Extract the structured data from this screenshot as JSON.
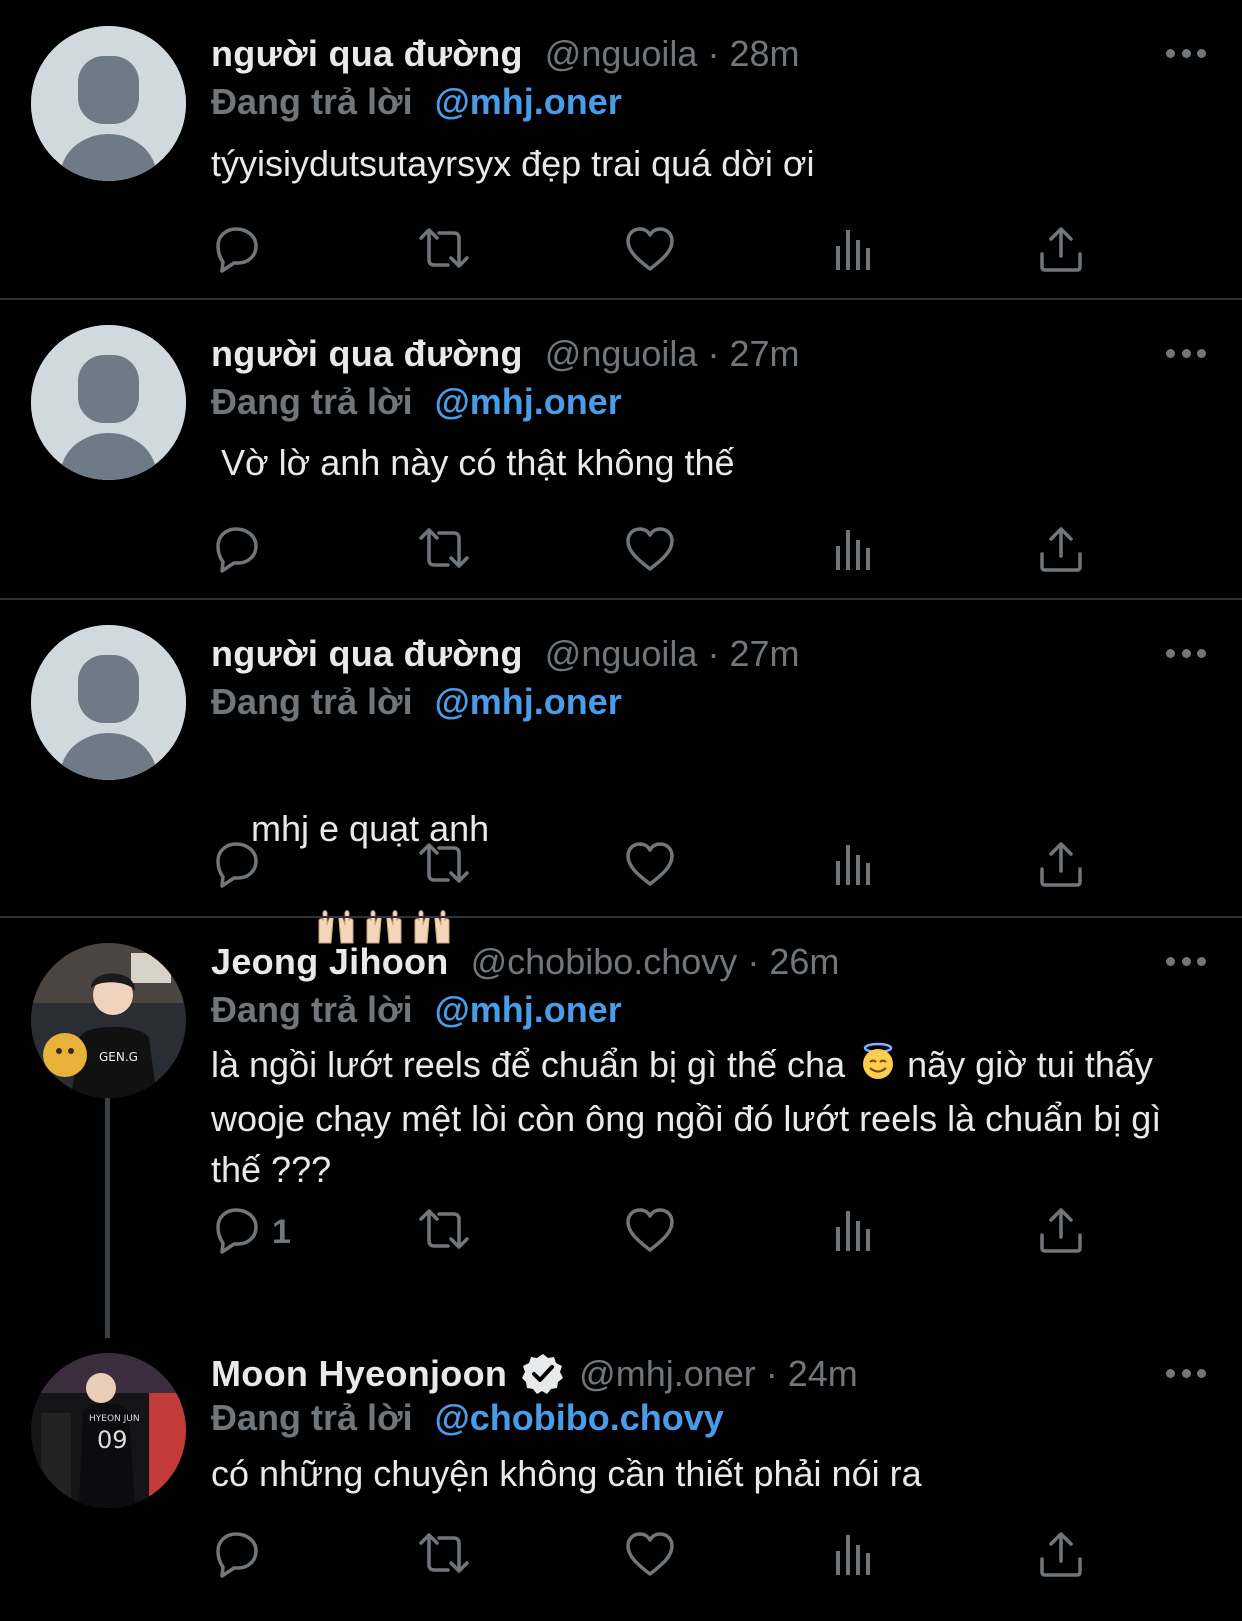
{
  "tweets": [
    {
      "name": "người qua đường",
      "handle": "@nguoila",
      "separator": "·",
      "time": "28m",
      "reply_label": "Đang trả lời",
      "reply_handle": "@mhj.oner",
      "text": "týyisiydutsutayrsyx đẹp trai quá dời ơi",
      "avatar": "default-avatar",
      "reply_count": ""
    },
    {
      "name": "người qua đường",
      "handle": "@nguoila",
      "separator": "·",
      "time": "27m",
      "reply_label": "Đang trả lời",
      "reply_handle": "@mhj.oner",
      "text": " Vờ lờ anh này có thật không thế",
      "avatar": "default-avatar",
      "reply_count": ""
    },
    {
      "name": "người qua đường",
      "handle": "@nguoila",
      "separator": "·",
      "time": "27m",
      "reply_label": "Đang trả lời",
      "reply_handle": "@mhj.oner",
      "text": "mhj e quạt anh",
      "emoji": "raising-hands-emoji x3",
      "avatar": "default-avatar",
      "reply_count": ""
    },
    {
      "name": "Jeong Jihoon",
      "handle": "@chobibo.chovy",
      "separator": "·",
      "time": "26m",
      "reply_label": "Đang trả lời",
      "reply_handle": "@mhj.oner",
      "text_part1": "là ngồi lướt reels để chuẩn bị gì thế cha",
      "text_part2": " nãy giờ tui thấy wooje chạy mệt lòi còn ông ngồi đó lướt reels là chuẩn bị gì thế ???",
      "emoji": "smiling-face-with-halo-emoji",
      "avatar": "photo-avatar",
      "reply_count": "1"
    },
    {
      "name": "Moon Hyeonjoon",
      "handle": "@mhj.oner",
      "separator": "·",
      "time": "24m",
      "reply_label": "Đang trả lời",
      "reply_handle": "@chobibo.chovy",
      "text": "có những chuyện không cần thiết phải nói ra",
      "verified": true,
      "avatar": "photo-avatar",
      "reply_count": ""
    }
  ],
  "colors": {
    "background": "#000000",
    "text": "#e7e9ea",
    "secondary": "#71767b",
    "link": "#4a9be8",
    "divider": "#2f3336"
  },
  "icons": [
    "reply-icon",
    "retweet-icon",
    "like-icon",
    "views-icon",
    "share-icon",
    "more-icon",
    "verified-badge-icon"
  ]
}
